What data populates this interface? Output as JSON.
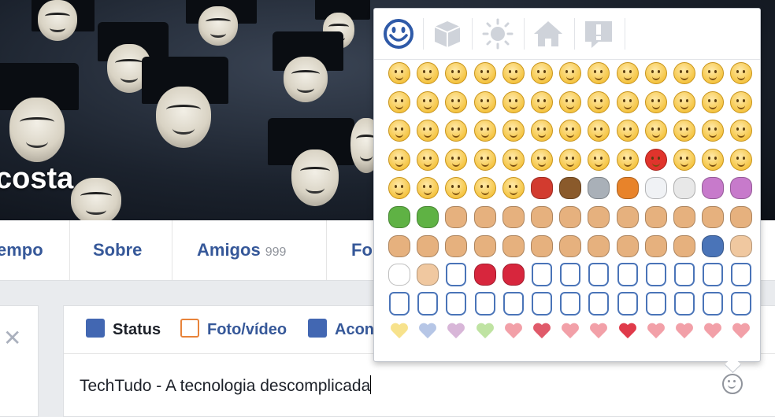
{
  "cover": {
    "name_fragment": "costa"
  },
  "nav": [
    {
      "label": "empo",
      "count": ""
    },
    {
      "label": "Sobre",
      "count": ""
    },
    {
      "label": "Amigos",
      "count": "999"
    },
    {
      "label": "Fo",
      "count": ""
    }
  ],
  "composer": {
    "tabs": [
      {
        "label": "Status",
        "icon": "pencil-icon",
        "color": "#4267b2"
      },
      {
        "label": "Foto/vídeo",
        "icon": "photo-icon",
        "color": "#e8833a"
      },
      {
        "label": "Acon",
        "icon": "flag-icon",
        "color": "#4267b2"
      }
    ],
    "text": "TechTudo - A tecnologia descomplicada"
  },
  "picker": {
    "tabs": [
      "smiley-icon",
      "cube-icon",
      "sun-icon",
      "house-icon",
      "exclamation-icon"
    ],
    "active_tab": 0,
    "rows": [
      [
        "face",
        "face",
        "face",
        "face",
        "face",
        "face",
        "face",
        "face",
        "face",
        "face",
        "face",
        "face",
        "face"
      ],
      [
        "face",
        "face",
        "face",
        "face",
        "face",
        "face",
        "face",
        "face",
        "face",
        "face",
        "face",
        "face",
        "face"
      ],
      [
        "face",
        "face",
        "face",
        "face",
        "face",
        "face",
        "face",
        "face",
        "face",
        "face",
        "face",
        "face",
        "face"
      ],
      [
        "face",
        "face",
        "face",
        "face",
        "face",
        "face",
        "face",
        "face",
        "face",
        "red",
        "face",
        "face",
        "face"
      ],
      [
        "face",
        "face",
        "face",
        "face",
        "face",
        "santa",
        "poo",
        "robot",
        "pumpkin",
        "ghost",
        "skull",
        "devil",
        "devil"
      ],
      [
        "alien",
        "alien",
        "person",
        "person",
        "person",
        "person",
        "person",
        "person",
        "person",
        "person",
        "person",
        "person",
        "person"
      ],
      [
        "person",
        "person",
        "person",
        "person",
        "person",
        "person",
        "person",
        "person",
        "person",
        "person",
        "person",
        "zzz",
        "ear"
      ],
      [
        "eyes",
        "nose",
        "hand",
        "lips",
        "lips",
        "hand",
        "hand",
        "hand",
        "hand",
        "hand",
        "hand",
        "hand",
        "hand"
      ],
      [
        "hand",
        "hand",
        "hand",
        "hand",
        "hand",
        "hand",
        "hand",
        "hand",
        "hand",
        "hand",
        "hand",
        "hand",
        "hand"
      ],
      [
        "heart-yellow",
        "heart-blue",
        "heart-purple",
        "heart-green",
        "heart-pink",
        "heart-broken",
        "heart-pink",
        "heart-pink",
        "heart-red",
        "heart-pink",
        "heart-pink",
        "heart-pink",
        "heart-pink"
      ]
    ],
    "colors": {
      "red": "#e0342c",
      "santa": "#d23b2f",
      "poo": "#8a5a2b",
      "robot": "#a9b0b8",
      "pumpkin": "#e8832a",
      "ghost": "#f0f2f5",
      "skull": "#e8e8e8",
      "devil": "#c77acb",
      "alien": "#5fb244",
      "person": "#e6b17e",
      "zzz": "#4a74b8",
      "ear": "#f0c8a0",
      "eyes": "#ffffff",
      "nose": "#f0c8a0",
      "lips": "#d7263d",
      "heart-yellow": "#f7e28c",
      "heart-blue": "#b6c6e6",
      "heart-purple": "#d8b6d8",
      "heart-green": "#bfe3a2",
      "heart-pink": "#f2a0a8",
      "heart-broken": "#e05a6a",
      "heart-red": "#e03a4a"
    }
  }
}
